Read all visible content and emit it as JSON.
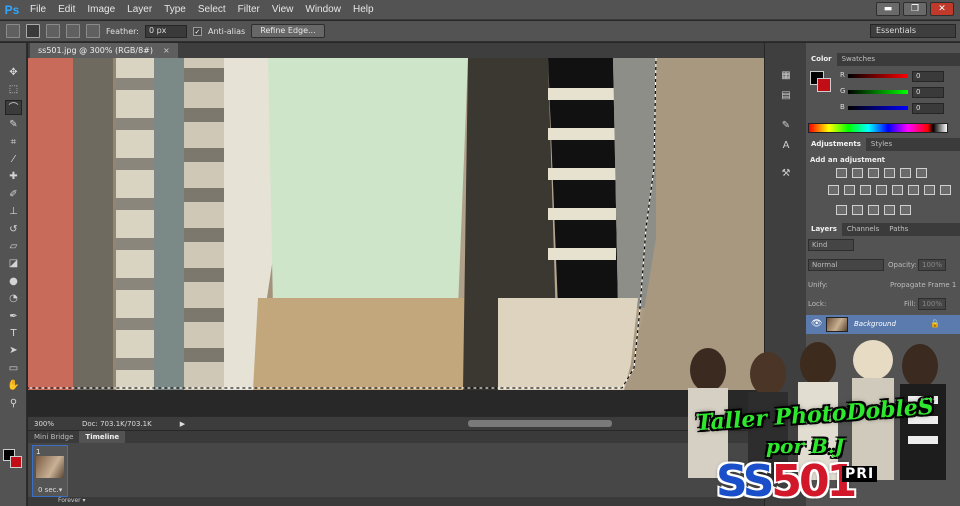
{
  "app": {
    "logo": "Ps"
  },
  "menu": [
    "File",
    "Edit",
    "Image",
    "Layer",
    "Type",
    "Select",
    "Filter",
    "View",
    "Window",
    "Help"
  ],
  "window_controls": {
    "minimize": "▬",
    "restore": "❐",
    "close": "✕"
  },
  "options": {
    "feather_label": "Feather:",
    "feather_value": "0 px",
    "antialias_label": "Anti-alias",
    "antialias_checked": "✓",
    "refine_label": "Refine Edge...",
    "workspace": "Essentials"
  },
  "tools": [
    {
      "name": "move-tool-icon",
      "glyph": "✥"
    },
    {
      "name": "marquee-tool-icon",
      "glyph": "⬚"
    },
    {
      "name": "lasso-tool-icon",
      "glyph": "⌒"
    },
    {
      "name": "quick-select-tool-icon",
      "glyph": "✎"
    },
    {
      "name": "crop-tool-icon",
      "glyph": "⌗"
    },
    {
      "name": "eyedropper-tool-icon",
      "glyph": "⁄"
    },
    {
      "name": "healing-tool-icon",
      "glyph": "✚"
    },
    {
      "name": "brush-tool-icon",
      "glyph": "✐"
    },
    {
      "name": "stamp-tool-icon",
      "glyph": "⊥"
    },
    {
      "name": "history-brush-tool-icon",
      "glyph": "↺"
    },
    {
      "name": "eraser-tool-icon",
      "glyph": "▱"
    },
    {
      "name": "bucket-tool-icon",
      "glyph": "◪"
    },
    {
      "name": "blur-tool-icon",
      "glyph": "●"
    },
    {
      "name": "dodge-tool-icon",
      "glyph": "◔"
    },
    {
      "name": "pen-tool-icon",
      "glyph": "✒"
    },
    {
      "name": "type-tool-icon",
      "glyph": "T"
    },
    {
      "name": "path-select-tool-icon",
      "glyph": "➤"
    },
    {
      "name": "shape-tool-icon",
      "glyph": "▭"
    },
    {
      "name": "hand-tool-icon",
      "glyph": "✋"
    },
    {
      "name": "zoom-tool-icon",
      "glyph": "⚲"
    }
  ],
  "document": {
    "tab_title": "ss501.jpg @ 300% (RGB/8#)",
    "close": "×"
  },
  "status": {
    "zoom": "300%",
    "doc_size": "Doc: 703.1K/703.1K",
    "arrow": "▶"
  },
  "timeline": {
    "tabs": [
      "Mini Bridge",
      "Timeline"
    ],
    "frame_number": "1",
    "frame_delay": "0 sec.▾",
    "loop": "Forever ▾"
  },
  "color_panel": {
    "tabs": [
      "Color",
      "Swatches"
    ],
    "channels": [
      {
        "label": "R",
        "value": "0",
        "gradient": "#ff0000"
      },
      {
        "label": "G",
        "value": "0",
        "gradient": "#00ff00"
      },
      {
        "label": "B",
        "value": "0",
        "gradient": "#0000ff"
      }
    ]
  },
  "adjustments_panel": {
    "tabs": [
      "Adjustments",
      "Styles"
    ],
    "title": "Add an adjustment"
  },
  "layers_panel": {
    "tabs": [
      "Layers",
      "Channels",
      "Paths"
    ],
    "kind": "Kind",
    "blend_mode": "Normal",
    "opacity_label": "Opacity:",
    "opacity_value": "100%",
    "unify_label": "Unify:",
    "propagate_label": "Propagate Frame 1",
    "lock_label": "Lock:",
    "fill_label": "Fill:",
    "fill_value": "100%",
    "layer_name": "Background",
    "eye": "👁",
    "lock": "🔒"
  },
  "watermark": {
    "title": "Taller PhotoDobleS",
    "by": "por B.J",
    "logo_blue": "SS",
    "logo_red": "501",
    "tag": "PRI"
  }
}
